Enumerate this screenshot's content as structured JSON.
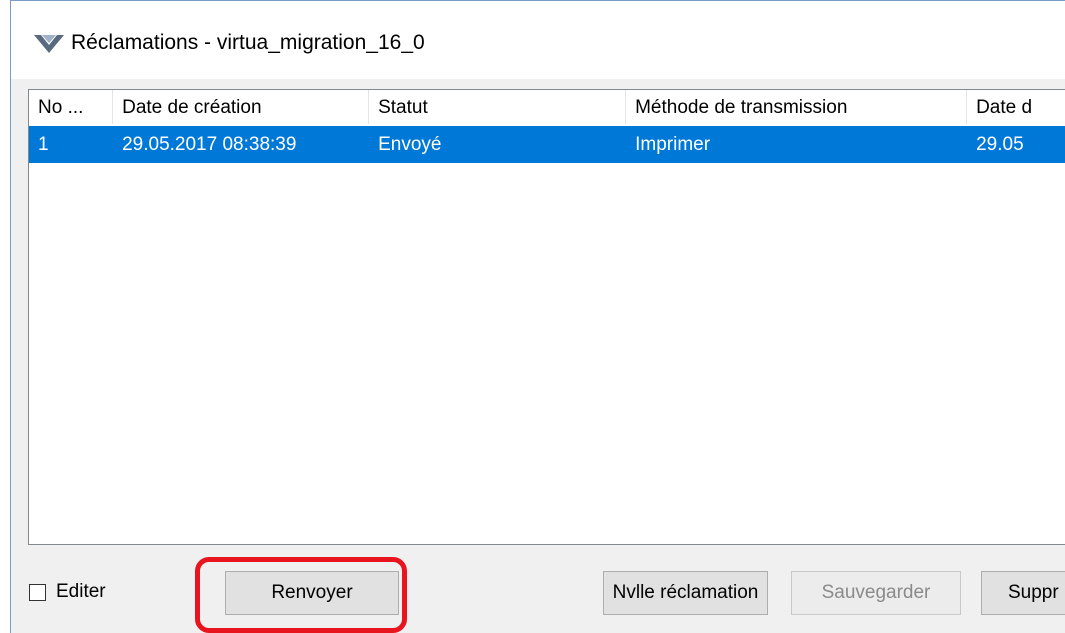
{
  "window": {
    "title": "Réclamations - virtua_migration_16_0"
  },
  "list": {
    "columns": [
      "No ...",
      "Date de création",
      "Statut",
      "Méthode de transmission",
      "Date d"
    ],
    "rows": [
      [
        "1",
        "29.05.2017 08:38:39",
        "Envoyé",
        "Imprimer",
        "29.05"
      ]
    ]
  },
  "controls": {
    "edit_checkbox_label": "Editer",
    "resend_label": "Renvoyer",
    "new_claim_label": "Nvlle réclamation",
    "save_label": "Sauvegarder",
    "delete_label": "Suppr"
  },
  "colors": {
    "selection": "#0078d7",
    "highlight": "#e8141e"
  }
}
